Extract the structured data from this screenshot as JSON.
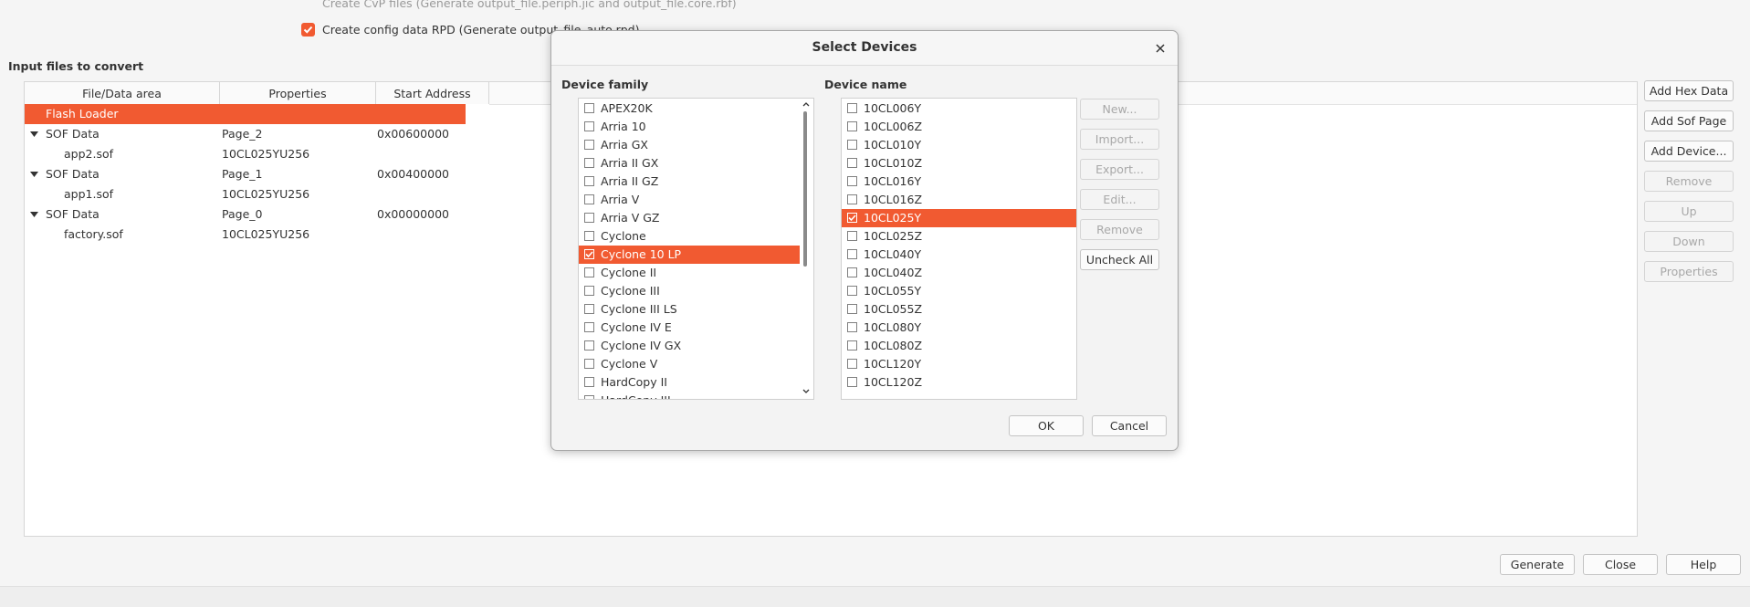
{
  "options": {
    "cvp_text": "Create CvP files (Generate output_file.periph.jic and output_file.core.rbf)",
    "rpd_text": "Create config data RPD (Generate output_file_auto.rpd)"
  },
  "input_files": {
    "title": "Input files to convert",
    "columns": [
      "File/Data area",
      "Properties",
      "Start Address"
    ],
    "rows": [
      {
        "name": "Flash Loader",
        "properties": "",
        "address": ""
      },
      {
        "name": "SOF Data",
        "properties": "Page_2",
        "address": "0x00600000"
      },
      {
        "name": "app2.sof",
        "properties": "10CL025YU256",
        "address": ""
      },
      {
        "name": "SOF Data",
        "properties": "Page_1",
        "address": "0x00400000"
      },
      {
        "name": "app1.sof",
        "properties": "10CL025YU256",
        "address": ""
      },
      {
        "name": "SOF Data",
        "properties": "Page_0",
        "address": "0x00000000"
      },
      {
        "name": "factory.sof",
        "properties": "10CL025YU256",
        "address": ""
      }
    ]
  },
  "side_buttons": {
    "add_hex_data": "Add Hex Data",
    "add_sof_page": "Add Sof Page",
    "add_device": "Add Device...",
    "remove": "Remove",
    "up": "Up",
    "down": "Down",
    "properties": "Properties"
  },
  "bottom_buttons": {
    "generate": "Generate",
    "close": "Close",
    "help": "Help"
  },
  "dialog": {
    "title": "Select Devices",
    "family_label": "Device family",
    "name_label": "Device name",
    "families": [
      "APEX20K",
      "Arria 10",
      "Arria GX",
      "Arria II GX",
      "Arria II GZ",
      "Arria V",
      "Arria V GZ",
      "Cyclone",
      "Cyclone 10 LP",
      "Cyclone II",
      "Cyclone III",
      "Cyclone III LS",
      "Cyclone IV E",
      "Cyclone IV GX",
      "Cyclone V",
      "HardCopy II",
      "HardCopy III"
    ],
    "selected_family": "Cyclone 10 LP",
    "devices": [
      "10CL006Y",
      "10CL006Z",
      "10CL010Y",
      "10CL010Z",
      "10CL016Y",
      "10CL016Z",
      "10CL025Y",
      "10CL025Z",
      "10CL040Y",
      "10CL040Z",
      "10CL055Y",
      "10CL055Z",
      "10CL080Y",
      "10CL080Z",
      "10CL120Y",
      "10CL120Z"
    ],
    "selected_device": "10CL025Y",
    "buttons": {
      "new": "New...",
      "import": "Import...",
      "export": "Export...",
      "edit": "Edit...",
      "remove": "Remove",
      "uncheck_all": "Uncheck All",
      "ok": "OK",
      "cancel": "Cancel"
    }
  },
  "colors": {
    "accent": "#f15a31"
  },
  "icons": {
    "close": "close-icon",
    "expand": "triangle-down-icon",
    "check": "checkmark-icon"
  }
}
